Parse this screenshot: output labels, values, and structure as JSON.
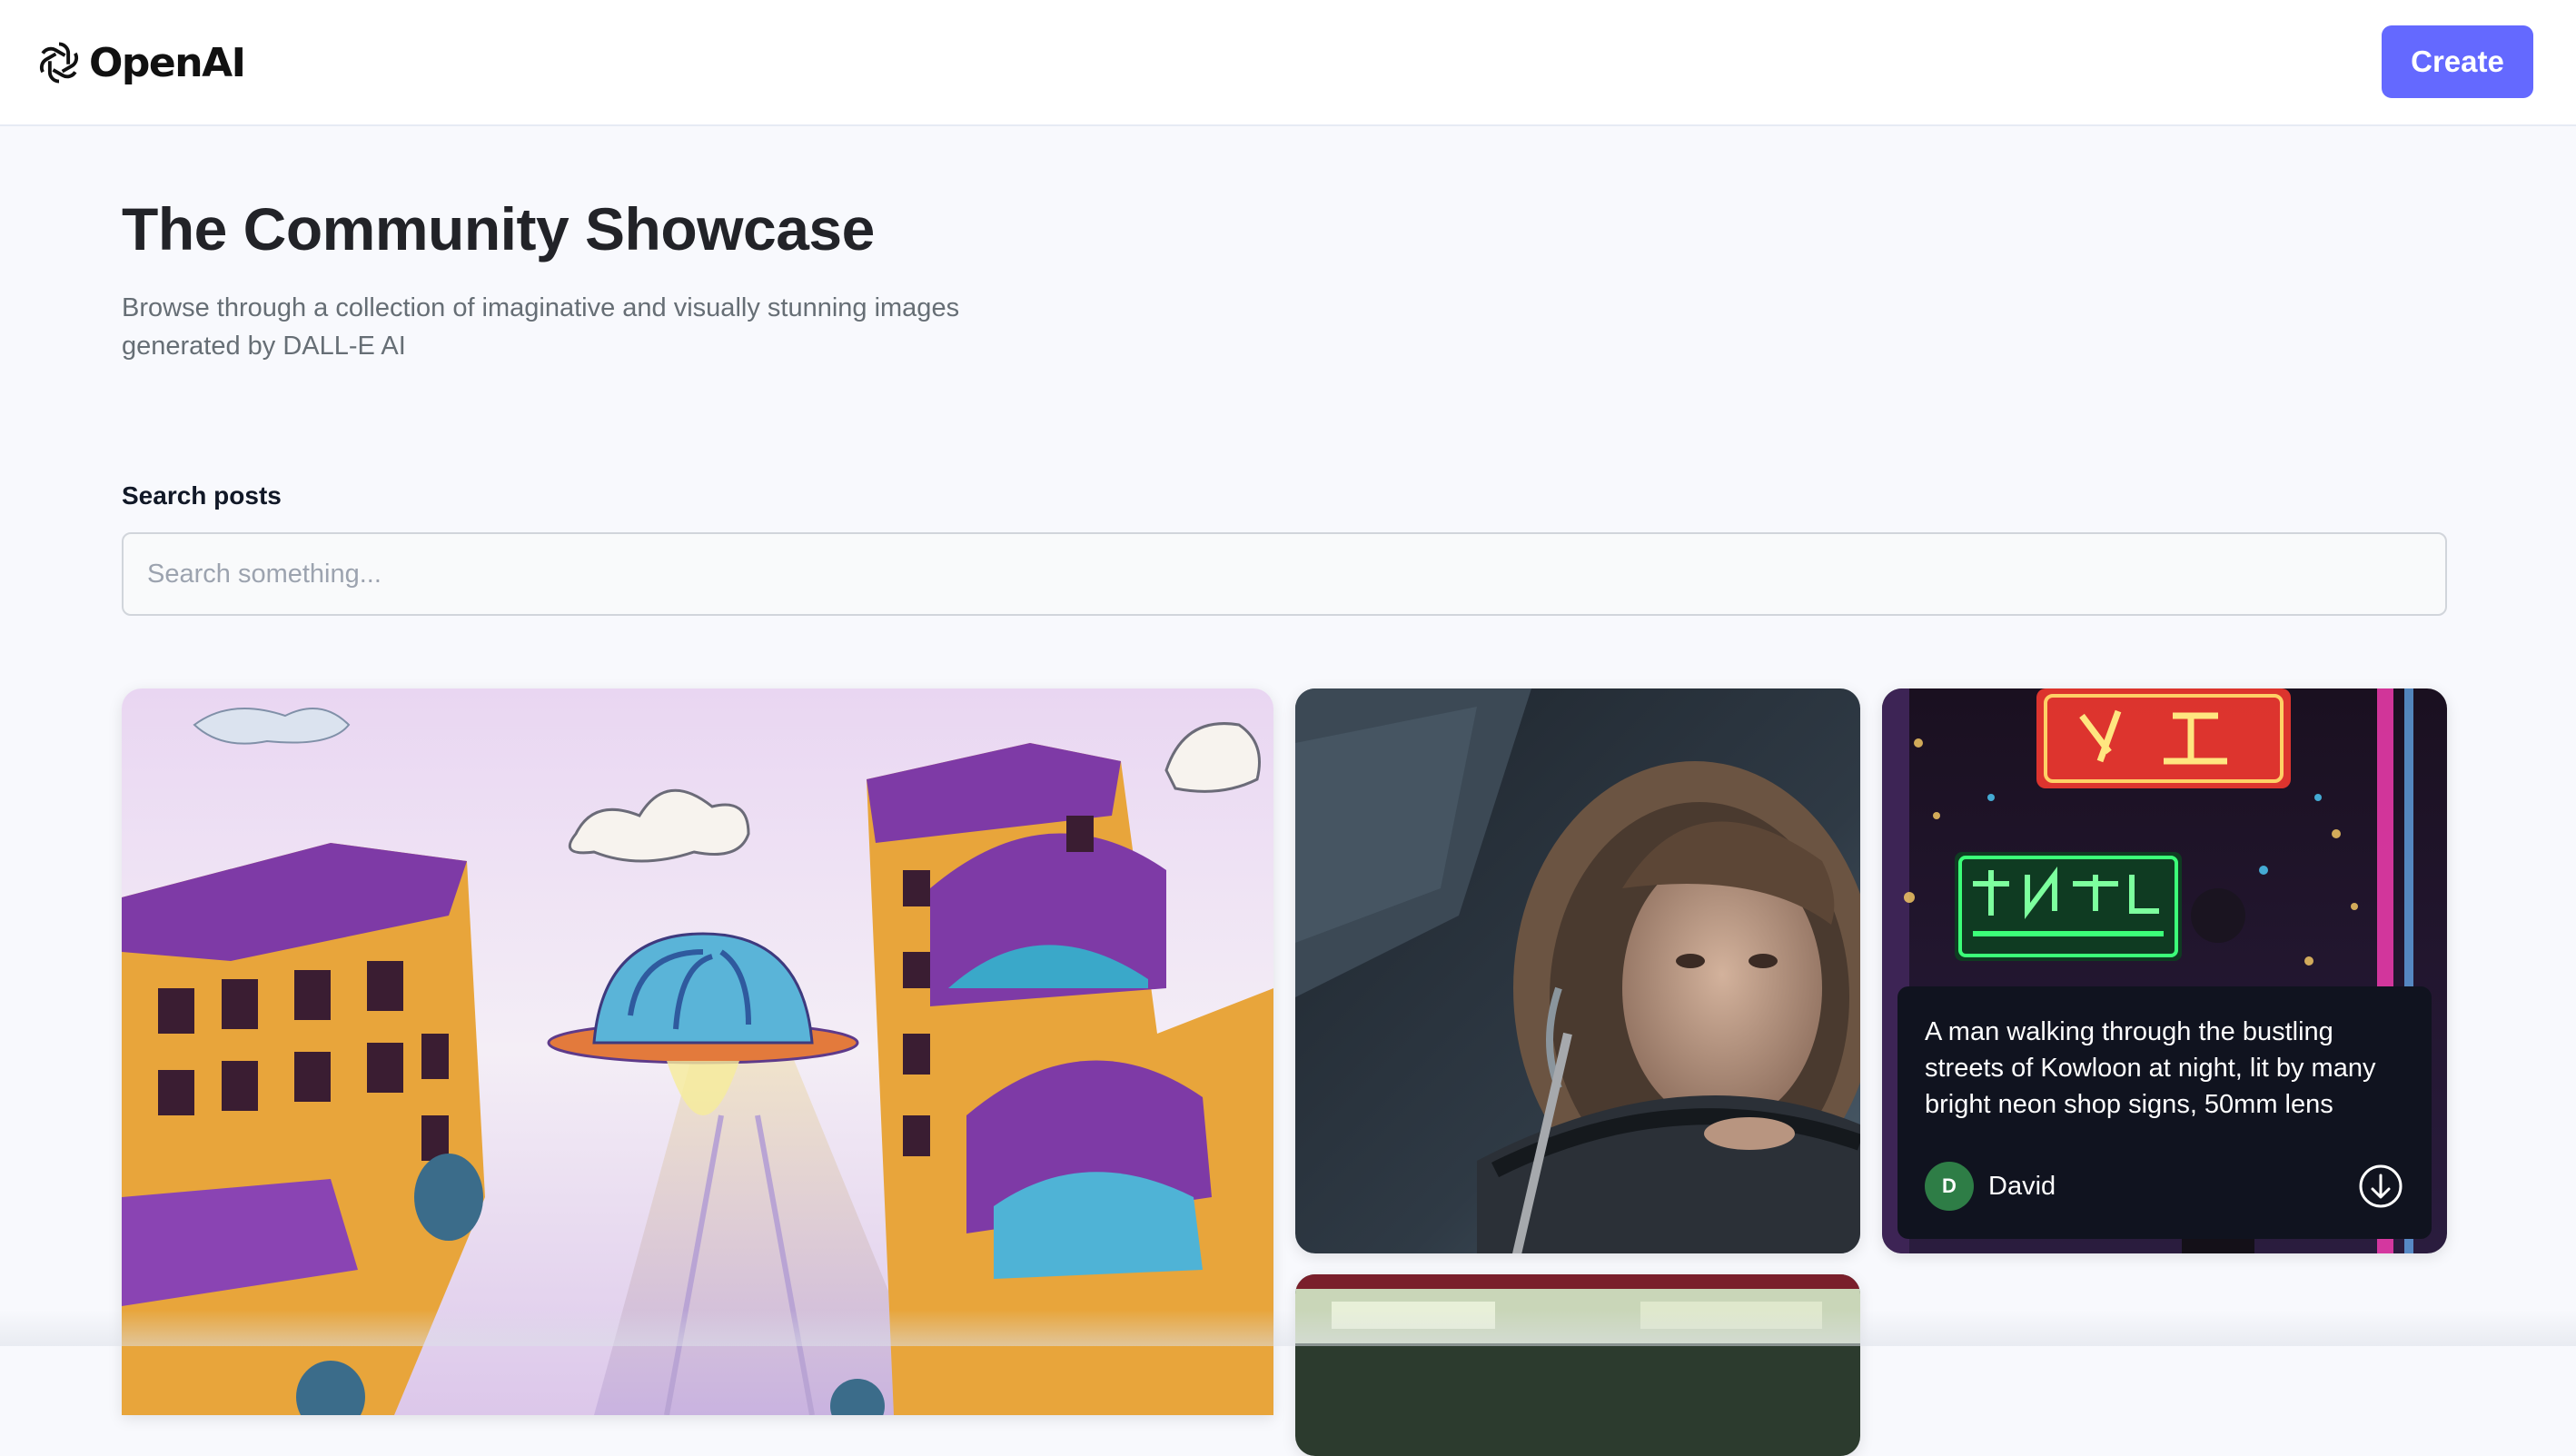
{
  "header": {
    "logo_text": "OpenAI",
    "logo_icon": "openai-logo-icon",
    "create_label": "Create"
  },
  "hero": {
    "title": "The Community Showcase",
    "subtitle": "Browse through a collection of imaginative and visually stunning images generated by DALL-E AI"
  },
  "search": {
    "label": "Search posts",
    "placeholder": "Search something...",
    "value": ""
  },
  "posts": [
    {
      "description": "watercolor city with flying saucer",
      "hovered": false
    },
    {
      "description": "boy in hooded jacket sitting in car",
      "hovered": false
    },
    {
      "description": "neon street at night",
      "hovered": true,
      "prompt": "A man walking through the bustling streets of Kowloon at night, lit by many bright neon shop signs, 50mm lens",
      "author": "David",
      "author_initial": "D",
      "download_icon": "download-icon"
    },
    {
      "description": "partially visible photo",
      "hovered": false
    }
  ],
  "colors": {
    "accent": "#6469ff",
    "page_background": "#f8f9fd",
    "overlay": "#10131f",
    "avatar": "#2e7d46"
  }
}
